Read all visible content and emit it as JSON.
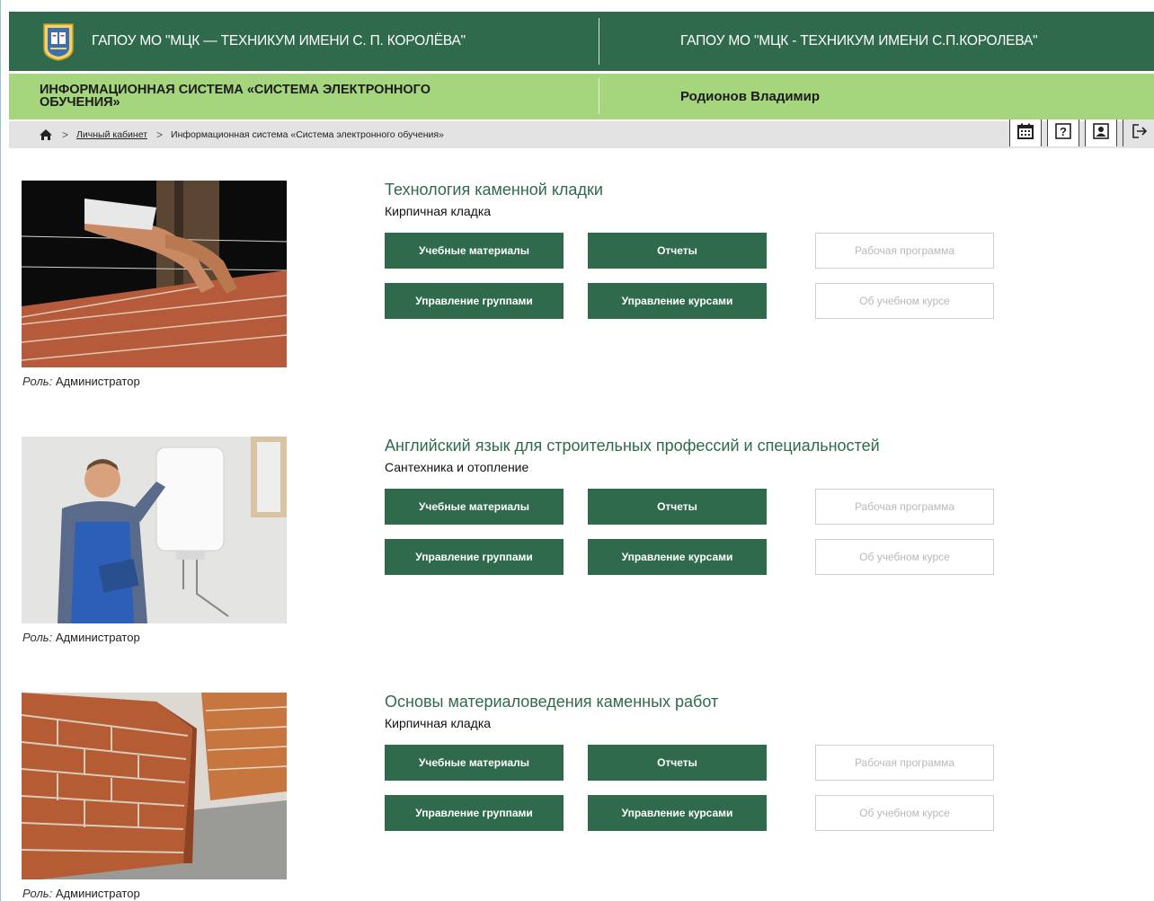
{
  "header": {
    "org_name_left": "ГАПОУ МО \"МЦК — ТЕХНИКУМ ИМЕНИ С. П. КОРОЛЁВА\"",
    "org_name_right": "ГАПОУ МО \"МЦК - ТЕХНИКУМ ИМЕНИ С.П.КОРОЛЕВА\"",
    "system_title": "ИНФОРМАЦИОННАЯ СИСТЕМА «СИСТЕМА ЭЛЕКТРОННОГО ОБУЧЕНИЯ»",
    "user_name": "Родионов Владимир"
  },
  "breadcrumb": {
    "home_icon": "home-icon",
    "separator": ">",
    "items": [
      {
        "label": "Личный кабинет"
      },
      {
        "label": "Информационная система «Система электронного обучения»"
      }
    ]
  },
  "toolbar": {
    "icons": [
      "calendar-icon",
      "help-icon",
      "profile-icon",
      "logout-icon"
    ],
    "help_glyph": "?"
  },
  "courses": [
    {
      "title": "Технология каменной кладки",
      "subtitle": "Кирпичная кладка",
      "image": "bricklaying-photo",
      "role_label": "Роль:",
      "role_value": "Администратор",
      "buttons": {
        "materials": "Учебные материалы",
        "reports": "Отчеты",
        "program": "Рабочая программа",
        "groups": "Управление группами",
        "manage_courses": "Управление курсами",
        "about": "Об учебном курсе"
      }
    },
    {
      "title": "Английский язык для строительных профессий и специальностей",
      "subtitle": "Сантехника и отопление",
      "image": "plumber-photo",
      "role_label": "Роль:",
      "role_value": "Администратор",
      "buttons": {
        "materials": "Учебные материалы",
        "reports": "Отчеты",
        "program": "Рабочая программа",
        "groups": "Управление группами",
        "manage_courses": "Управление курсами",
        "about": "Об учебном курсе"
      }
    },
    {
      "title": "Основы материаловедения каменных работ",
      "subtitle": "Кирпичная кладка",
      "image": "brick-wall-photo",
      "role_label": "Роль:",
      "role_value": "Администратор",
      "buttons": {
        "materials": "Учебные материалы",
        "reports": "Отчеты",
        "program": "Рабочая программа",
        "groups": "Управление группами",
        "manage_courses": "Управление курсами",
        "about": "Об учебном курсе"
      }
    }
  ],
  "colors": {
    "header_dark": "#2f6a4c",
    "header_light": "#a5d57c",
    "breadcrumb_bg": "#e3e3e3",
    "button_green": "#2f6a4c",
    "disabled_text": "#b9b9b9"
  }
}
